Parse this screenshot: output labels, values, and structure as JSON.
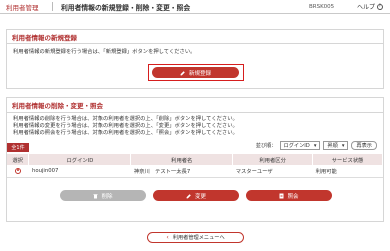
{
  "topbar": {
    "menu": "利用者管理",
    "title": "利用者情報の新規登録・削除・変更・照会",
    "screen_code": "BRSK005",
    "help": "ヘルプ",
    "help_icon": "?"
  },
  "register": {
    "heading": "利用者情報の新規登録",
    "description": "利用者情報の新規登録を行う場合は、「新規登録」ボタンを押してください。",
    "button_label": "新規登録"
  },
  "manage": {
    "heading": "利用者情報の削除・変更・照会",
    "descriptions": [
      "利用者情報の削除を行う場合は、対象の利用者を選択の上、「削除」ボタンを押してください。",
      "利用者情報の変更を行う場合は、対象の利用者を選択の上、「変更」ボタンを押してください。",
      "利用者情報の照会を行う場合は、対象の利用者を選択の上、「照会」ボタンを押してください。"
    ],
    "count_badge": "全1件",
    "sort_label": "並び順：",
    "sort_field": "ログインID",
    "sort_order": "昇順",
    "redisplay": "再表示",
    "columns": [
      "選択",
      "ログインID",
      "利用者名",
      "利用者区分",
      "サービス状態"
    ],
    "rows": [
      {
        "login_id": "houjin007",
        "name": "神奈川　テスト⼀太⻑7",
        "category": "マスターユーザ",
        "status": "利用可能"
      }
    ],
    "delete_label": "削除",
    "change_label": "変更",
    "inquiry_label": "照会"
  },
  "back_label": "利用者管理メニューへ",
  "colors": {
    "accent": "#c1362d",
    "heading": "#b03030",
    "table_header": "#efe2e2"
  }
}
